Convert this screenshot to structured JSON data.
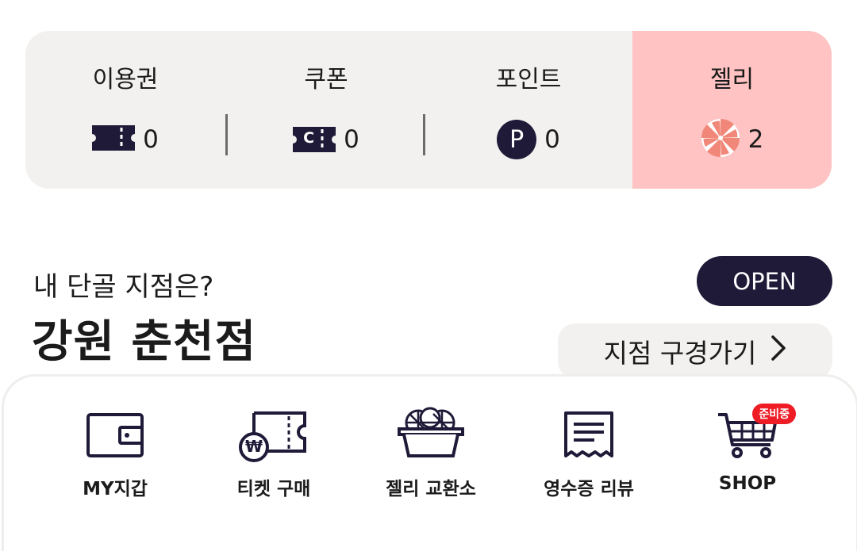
{
  "stats": [
    {
      "label": "이용권",
      "value": "0",
      "icon": "ticket-icon"
    },
    {
      "label": "쿠폰",
      "value": "0",
      "icon": "coupon-icon"
    },
    {
      "label": "포인트",
      "value": "0",
      "icon": "point-icon",
      "icon_text": "P"
    },
    {
      "label": "젤리",
      "value": "2",
      "icon": "jelly-candy-icon"
    }
  ],
  "coupon_icon_letter": "C",
  "store_question": "내 단골 지점은?",
  "store_name": "강원 춘천점",
  "open_label": "OPEN",
  "tour_label": "지점 구경가기",
  "menu": [
    {
      "label": "MY지갑",
      "icon": "wallet-icon"
    },
    {
      "label": "티켓 구매",
      "icon": "ticket-purchase-icon",
      "icon_text": "₩"
    },
    {
      "label": "젤리 교환소",
      "icon": "jelly-basket-icon"
    },
    {
      "label": "영수증 리뷰",
      "icon": "receipt-icon"
    },
    {
      "label": "SHOP",
      "icon": "cart-icon",
      "badge": "준비중"
    }
  ],
  "colors": {
    "navy": "#1e1a38",
    "jelly_bg": "#fec3c2",
    "card_bg": "#f2f1ef",
    "badge": "#ee1c25"
  }
}
